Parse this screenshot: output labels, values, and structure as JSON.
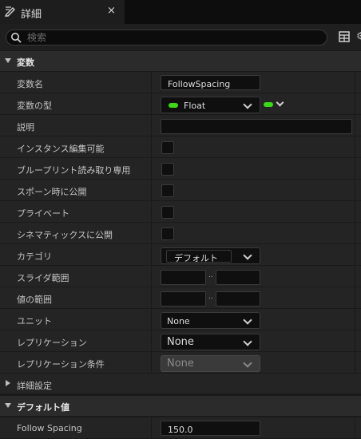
{
  "tab": {
    "title": "詳細",
    "close": "×"
  },
  "search": {
    "placeholder": "検索",
    "value": ""
  },
  "sections": {
    "variable": "変数",
    "default": "デフォルト値"
  },
  "rows": {
    "var_name": {
      "label": "変数名",
      "value": "FollowSpacing"
    },
    "var_type": {
      "label": "変数の型",
      "value": "Float",
      "type_color": "#3bd916"
    },
    "description": {
      "label": "説明",
      "value": ""
    },
    "instance_editable": {
      "label": "インスタンス編集可能",
      "checked": false
    },
    "bp_readonly": {
      "label": "ブループリント読み取り専用",
      "checked": false
    },
    "expose_spawn": {
      "label": "スポーン時に公開",
      "checked": false
    },
    "private": {
      "label": "プライベート",
      "checked": false
    },
    "expose_cinematics": {
      "label": "シネマティックスに公開",
      "checked": false
    },
    "category": {
      "label": "カテゴリ",
      "value": "デフォルト"
    },
    "slider_range": {
      "label": "スライダ範囲",
      "min": "",
      "max": "",
      "sep": ".."
    },
    "value_range": {
      "label": "値の範囲",
      "min": "",
      "max": "",
      "sep": ".."
    },
    "units": {
      "label": "ユニット",
      "value": "None"
    },
    "replication": {
      "label": "レプリケーション",
      "value": "None"
    },
    "replication_condition": {
      "label": "レプリケーション条件",
      "value": "None"
    },
    "advanced": {
      "label": "詳細設定"
    },
    "follow_spacing": {
      "label": "Follow Spacing",
      "value": "150.0"
    }
  },
  "colors": {
    "accent_green": "#3bd916",
    "panel": "#242424",
    "header": "#2b2b2b"
  }
}
